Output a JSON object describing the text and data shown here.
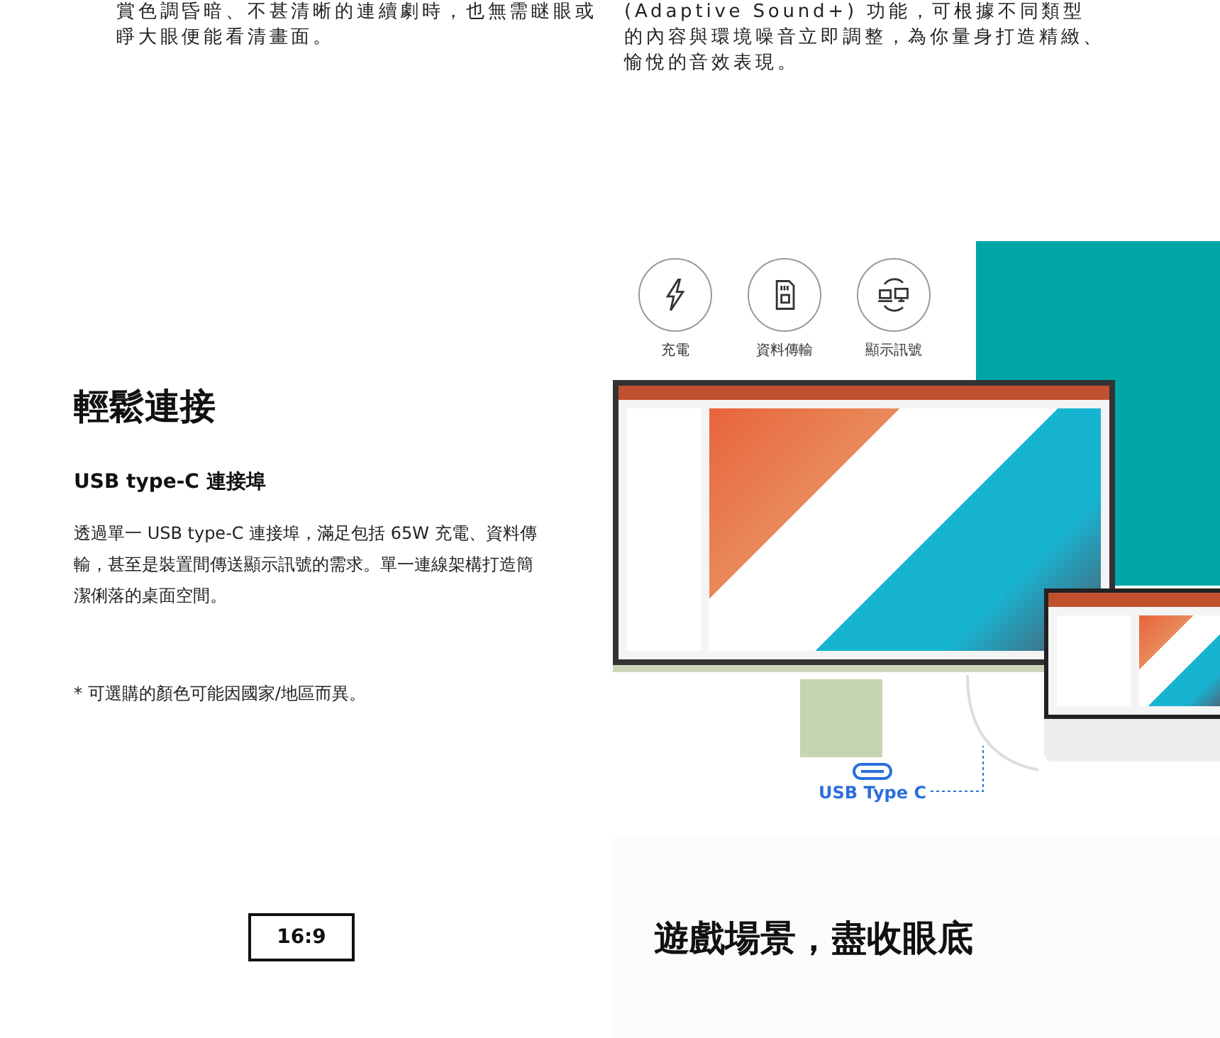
{
  "intro_columns": [
    {
      "text": "賞色調昏暗、不甚清晰的連續劇時，也無需瞇眼或睜大眼便能看清畫面。"
    },
    {
      "text": "(Adaptive Sound+) 功能，可根據不同類型的內容與環境噪音立即調整，為你量身打造精緻、愉悅的音效表現。"
    }
  ],
  "connect_section": {
    "title": "輕鬆連接",
    "subtitle": "USB type-C 連接埠",
    "body": "透過單一 USB type-C 連接埠，滿足包括 65W 充電、資料傳輸，甚至是裝置間傳送顯示訊號的需求。單一連線架構打造簡潔俐落的桌面空間。",
    "note": "* 可選購的顏色可能因國家/地區而異。",
    "features": [
      {
        "kind": "charge",
        "label": "充電"
      },
      {
        "kind": "data",
        "label": "資料傳輸"
      },
      {
        "kind": "display",
        "label": "顯示訊號"
      }
    ],
    "port_label": "USB Type C"
  },
  "next_section": {
    "ratio_badge": "16:9",
    "title": "遊戲場景，盡收眼底"
  }
}
